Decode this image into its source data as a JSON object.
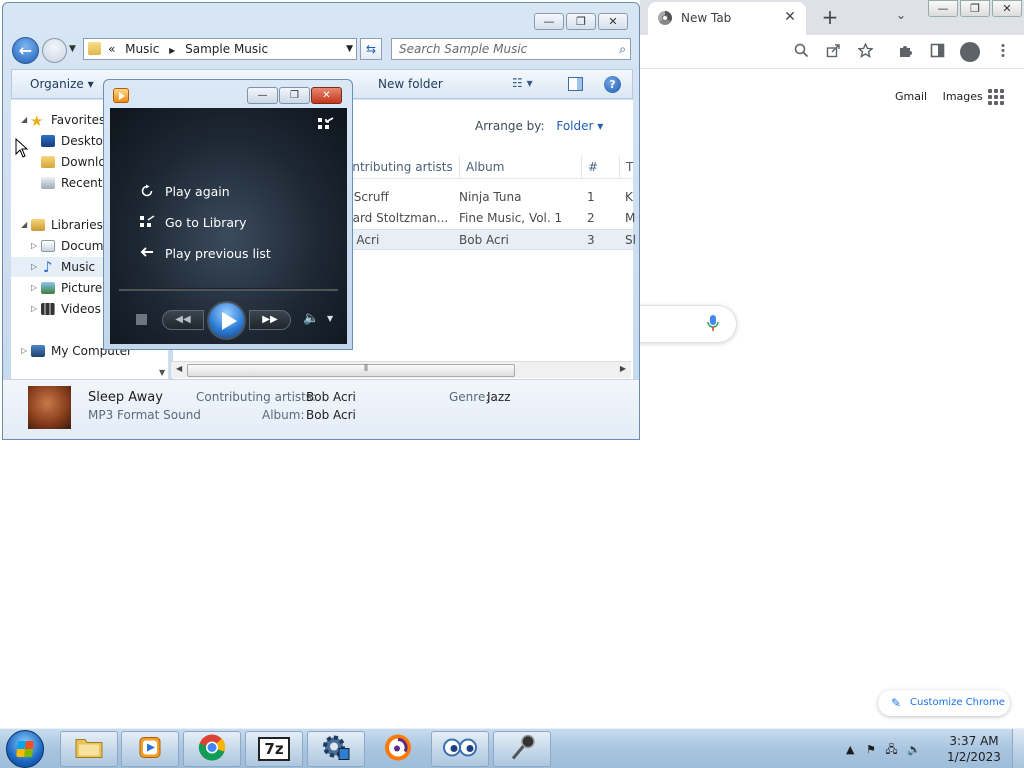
{
  "chrome": {
    "tab_title": "New Tab",
    "tab_close": "✕",
    "new_tab": "+",
    "tab_search": "⌄",
    "win_min": "—",
    "win_restore": "❐",
    "win_close": "✕",
    "toolbar_icons": [
      "zoom-icon",
      "share-icon",
      "bookmark-star-icon",
      "extensions-puzzle-icon",
      "side-panel-icon",
      "profile-avatar-icon",
      "more-menu-icon"
    ],
    "gmail_link": "Gmail",
    "images_link": "Images",
    "customize_label": "Customize Chrome"
  },
  "explorer": {
    "win_min": "—",
    "win_restore": "❐",
    "win_close": "✕",
    "breadcrumb_prefix": "«",
    "breadcrumb": [
      "Music",
      "Sample Music"
    ],
    "search_placeholder": "Search Sample Music",
    "toolbar": {
      "organize": "Organize ▾",
      "new_folder": "New folder"
    },
    "nav": {
      "favorites": "Favorites",
      "desktop": "Desktop",
      "downloads": "Downlo",
      "recent": "Recent P",
      "libraries": "Libraries",
      "documents": "Docume",
      "music": "Music",
      "pictures": "Pictures",
      "videos": "Videos",
      "computer": "My Computer"
    },
    "arrange_by_label": "Arrange by:",
    "arrange_by_value": "Folder ▾",
    "columns": [
      "ontributing artists",
      "Album",
      "#",
      "T"
    ],
    "rows": [
      {
        "artist": "r Scruff",
        "album": "Ninja Tuna",
        "num": "1",
        "t": "K"
      },
      {
        "artist": "hard Stoltzman...",
        "album": "Fine Music, Vol. 1",
        "num": "2",
        "t": "M"
      },
      {
        "artist": "b Acri",
        "album": "Bob Acri",
        "num": "3",
        "t": "Sl"
      }
    ],
    "details": {
      "title": "Sleep Away",
      "type": "MP3 Format Sound",
      "artists_label": "Contributing artists:",
      "artists_value": "Bob Acri",
      "album_label": "Album:",
      "album_value": "Bob Acri",
      "genre_label": "Genre:",
      "genre_value": "Jazz"
    }
  },
  "media_player": {
    "win_min": "—",
    "win_restore": "❐",
    "win_close": "✕",
    "menu": [
      "Play again",
      "Go to Library",
      "Play previous list"
    ]
  },
  "taskbar": {
    "apps": [
      "explorer",
      "media-player",
      "chrome",
      "7-zip",
      "settings",
      "avast",
      "eyes",
      "microphone"
    ],
    "seven_zip_label": "7z",
    "time": "3:37 AM",
    "date": "1/2/2023"
  },
  "colors": {
    "accent": "#1e5fb5",
    "chrome_tabbar": "#dee1e6",
    "taskbar": "#a9c5e0"
  }
}
